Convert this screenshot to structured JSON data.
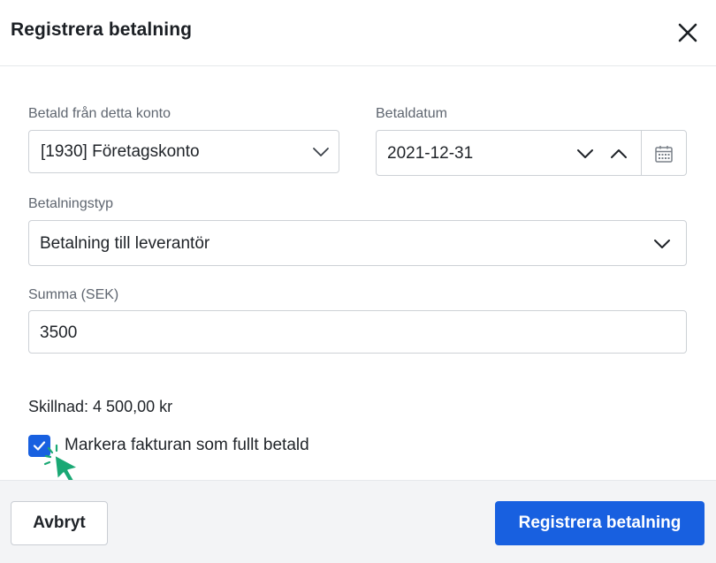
{
  "dialog": {
    "title": "Registrera betalning"
  },
  "form": {
    "account": {
      "label": "Betald från detta konto",
      "value": "[1930] Företagskonto"
    },
    "date": {
      "label": "Betaldatum",
      "value": "2021-12-31"
    },
    "payment_type": {
      "label": "Betalningstyp",
      "value": "Betalning till leverantör"
    },
    "amount": {
      "label": "Summa (SEK)",
      "value": "3500"
    },
    "difference": "Skillnad: 4 500,00 kr",
    "mark_paid": {
      "label": "Markera fakturan som fullt betald",
      "checked": true
    }
  },
  "footer": {
    "cancel_label": "Avbryt",
    "submit_label": "Registrera betalning"
  },
  "colors": {
    "primary": "#1860e0",
    "cursor": "#1aa874"
  },
  "icons": {
    "close": "close-icon",
    "chevron": "chevron-down-icon",
    "chevron_up": "chevron-up-icon",
    "calendar": "calendar-icon",
    "check": "checkmark-icon",
    "cursor": "mouse-pointer-icon"
  }
}
